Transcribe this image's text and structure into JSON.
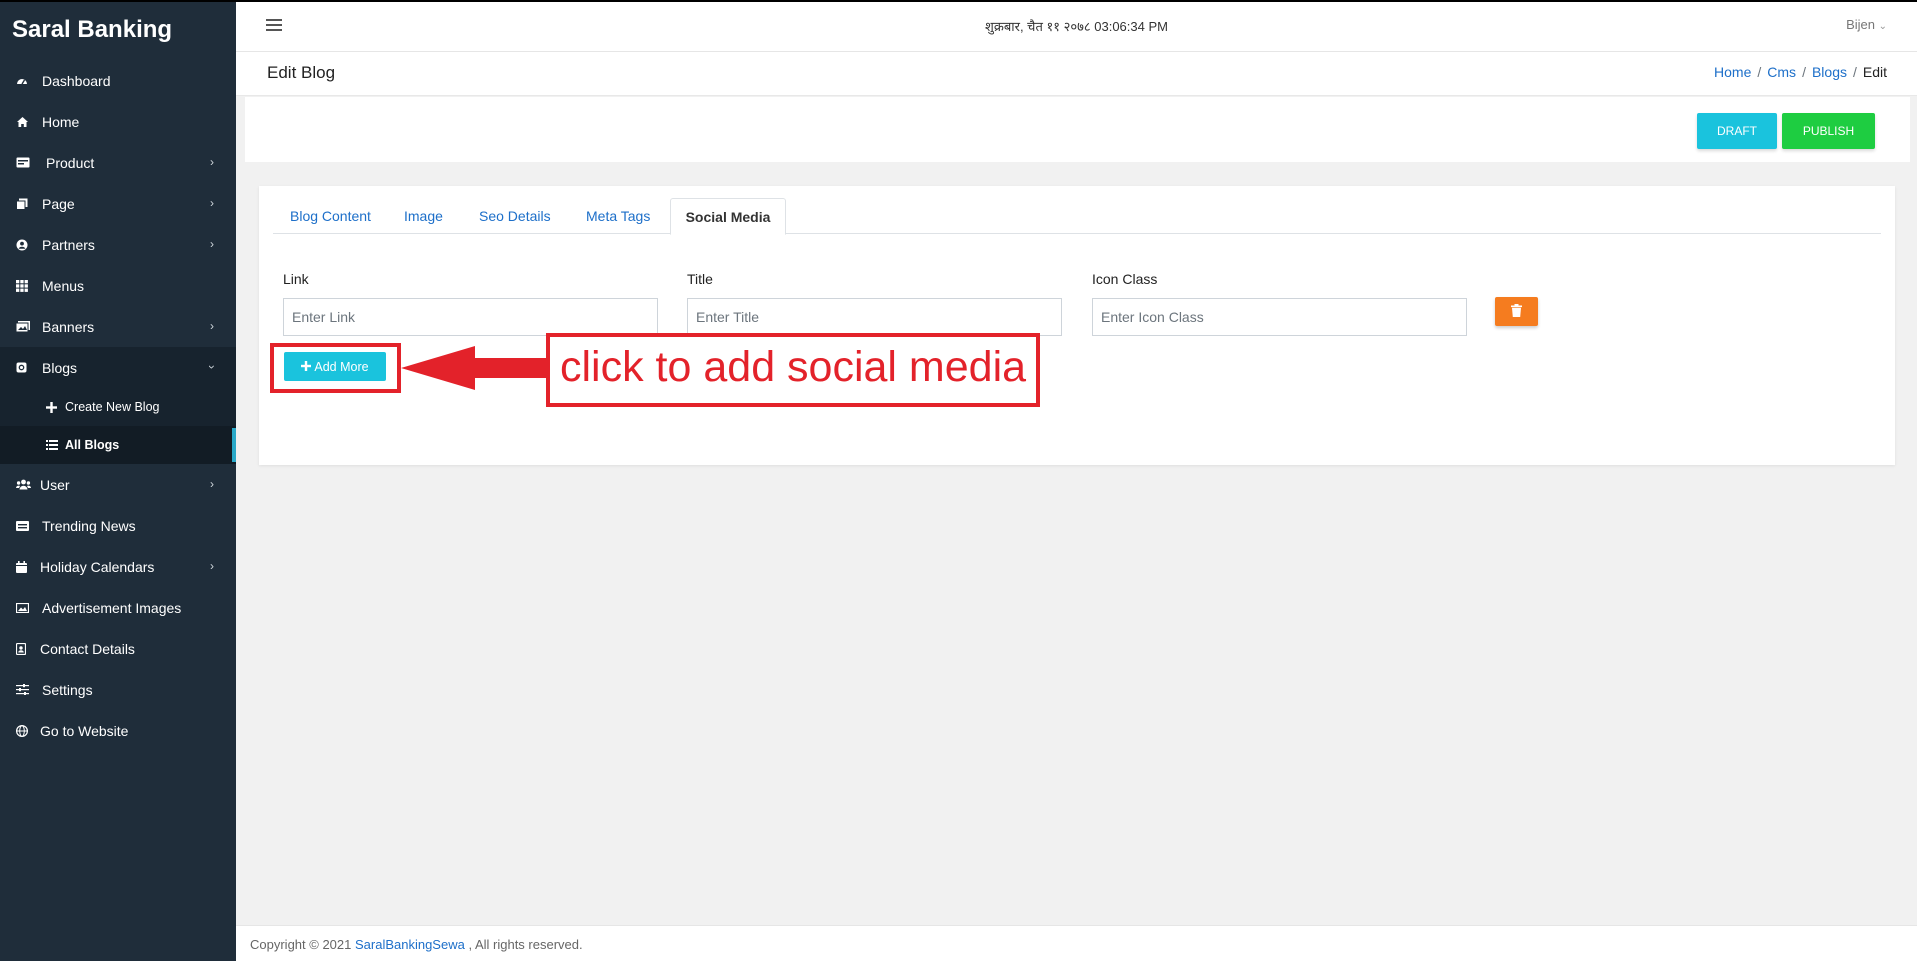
{
  "brand": "Saral Banking",
  "sidebar": {
    "items": [
      {
        "label": "Dashboard"
      },
      {
        "label": "Home"
      },
      {
        "label": "Product"
      },
      {
        "label": "Page"
      },
      {
        "label": "Partners"
      },
      {
        "label": "Menus"
      },
      {
        "label": "Banners"
      },
      {
        "label": "Blogs"
      },
      {
        "label": "User"
      },
      {
        "label": "Trending News"
      },
      {
        "label": "Holiday Calendars"
      },
      {
        "label": "Advertisement Images"
      },
      {
        "label": "Contact Details"
      },
      {
        "label": "Settings"
      },
      {
        "label": "Go to Website"
      }
    ],
    "blog_sub": [
      {
        "label": "Create New Blog"
      },
      {
        "label": "All Blogs"
      }
    ]
  },
  "header": {
    "datetime": "शुक्रबार, चैत ११ २०७८ 03:06:34 PM",
    "user": "Bijen"
  },
  "page": {
    "title": "Edit Blog",
    "breadcrumb": [
      "Home",
      "Cms",
      "Blogs",
      "Edit"
    ]
  },
  "actions": {
    "draft": "DRAFT",
    "publish": "PUBLISH"
  },
  "tabs": [
    "Blog Content",
    "Image",
    "Seo Details",
    "Meta Tags",
    "Social Media"
  ],
  "form": {
    "link_label": "Link",
    "link_placeholder": "Enter Link",
    "title_label": "Title",
    "title_placeholder": "Enter Title",
    "icon_label": "Icon Class",
    "icon_placeholder": "Enter Icon Class",
    "add_more": "Add More"
  },
  "annotation": {
    "text": "click to add social media"
  },
  "footer": {
    "prefix": "Copyright © 2021 ",
    "link": "SaralBankingSewa",
    "suffix": " , All rights reserved."
  },
  "colors": {
    "sidebar_bg": "#1f2d3a",
    "accent_cyan": "#1ac3dd",
    "publish_green": "#1ecd41",
    "delete_orange": "#f57c1f",
    "annotation_red": "#e3222a",
    "link_blue": "#1d6fc9"
  }
}
